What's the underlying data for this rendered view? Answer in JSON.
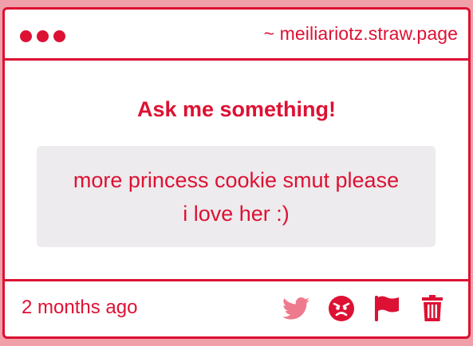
{
  "header": {
    "url": "~ meiliariotz.straw.page"
  },
  "main": {
    "title": "Ask me something!",
    "question_lines": [
      "more princess cookie smut please",
      "i love her :)"
    ]
  },
  "footer": {
    "timestamp": "2 months ago",
    "icons": [
      "twitter-icon",
      "angry-face-icon",
      "flag-icon",
      "trash-icon"
    ]
  },
  "colors": {
    "accent": "#dd1133",
    "twitter_icon": "#ee7b8d",
    "page_background": "#f0a0a9",
    "question_background": "#edebed"
  }
}
